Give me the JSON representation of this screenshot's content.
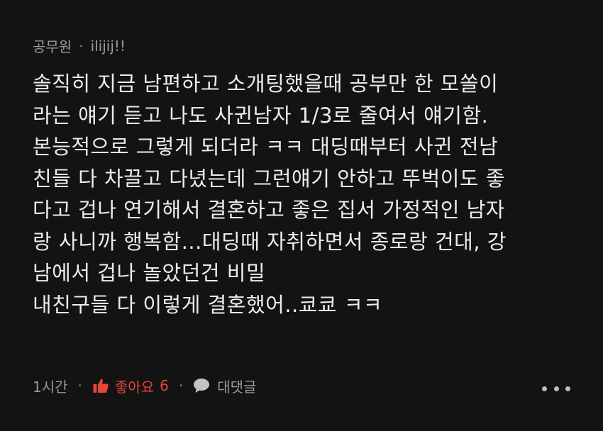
{
  "comment": {
    "author": "공무원",
    "separator": "·",
    "nickname": "ilijij!!",
    "lines": [
      "솔직히 지금 남편하고 소개팅했을때 공부만 한 모쏠이",
      "라는 얘기 듣고 나도 사귄남자 1/3로 줄여서 얘기함.",
      "본능적으로 그렇게 되더라 ㅋㅋ 대딩때부터 사귄 전남",
      "친들 다 차끌고 다녔는데 그런얘기 안하고 뚜벅이도 좋",
      "다고 겁나 연기해서 결혼하고 좋은 집서 가정적인 남자",
      "랑 사니까 행복함...대딩때 자취하면서 종로랑 건대, 강",
      "남에서 겁나 놀았던건 비밀",
      "내친구들 다 이렇게 결혼했어..쿄쿄 ㅋㅋ"
    ],
    "time": "1시간",
    "dot": "·",
    "like_label": "좋아요",
    "like_count": "6",
    "reply_label": "대댓글"
  },
  "colors": {
    "background": "#131313",
    "text": "#ececec",
    "meta": "#9a9a9a",
    "like_accent": "#e8453c"
  },
  "icons": {
    "like": "thumbs-up-icon",
    "reply": "speech-bubble-icon",
    "more": "more-dots-icon"
  }
}
